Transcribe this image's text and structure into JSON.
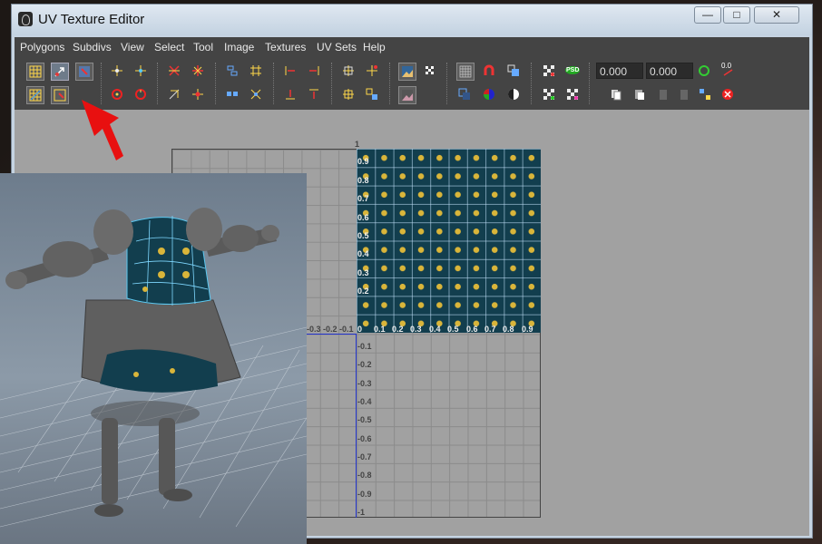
{
  "window": {
    "title": "UV Texture Editor"
  },
  "menu": [
    "Polygons",
    "Subdivs",
    "View",
    "Select",
    "Tool",
    "Image",
    "Textures",
    "UV Sets",
    "Help"
  ],
  "fields": {
    "u_value": "0.000",
    "v_value": "0.000"
  },
  "icons": {
    "psd": "PSD",
    "uv_small": "0.0"
  },
  "labels": {
    "top": "1",
    "y_pos": [
      "0.9",
      "0.8",
      "0.7",
      "0.6",
      "0.5",
      "0.4",
      "0.3",
      "0.2"
    ],
    "x_neg": [
      "-0.3",
      "-0.2",
      "-0.1"
    ],
    "origin": "0",
    "x_pos": [
      "0.1",
      "0.2",
      "0.3",
      "0.4",
      "0.5",
      "0.6",
      "0.7",
      "0.8",
      "0.9"
    ],
    "y_neg": [
      "-0.1",
      "-0.2",
      "-0.3",
      "-0.4",
      "-0.5",
      "-0.6",
      "-0.7",
      "-0.8",
      "-0.9",
      "-1"
    ]
  },
  "colors": {
    "texture_bg": "#123e4e",
    "fleur": "#d9b53a",
    "arrow": "#e81010",
    "axis": "#2233cc"
  }
}
